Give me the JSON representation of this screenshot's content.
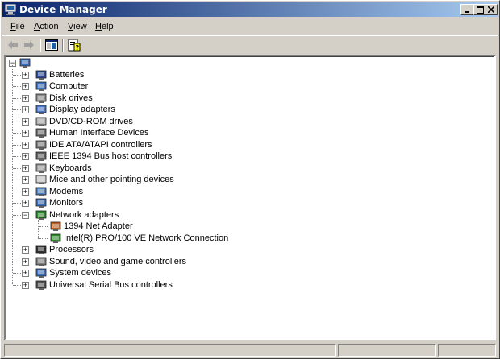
{
  "window": {
    "title": "Device Manager",
    "colors": {
      "titlebar_start": "#0a246a",
      "titlebar_end": "#a6caf0",
      "chrome": "#d4d0c8"
    }
  },
  "titlebar_buttons": {
    "minimize_icon": "minimize-icon",
    "maximize_icon": "maximize-icon",
    "close_icon": "close-icon"
  },
  "menu": {
    "file": {
      "accel": "F",
      "rest": "ile"
    },
    "action": {
      "accel": "A",
      "rest": "ction"
    },
    "view": {
      "accel": "V",
      "rest": "iew"
    },
    "help": {
      "accel": "H",
      "rest": "elp"
    }
  },
  "toolbar": {
    "back_icon": "back-arrow-icon",
    "forward_icon": "forward-arrow-icon",
    "console_tree_icon": "console-tree-icon",
    "properties_icon": "properties-help-icon"
  },
  "tree": {
    "root_label": "",
    "items": [
      {
        "label": "Batteries",
        "icon": "battery-icon"
      },
      {
        "label": "Computer",
        "icon": "computer-icon"
      },
      {
        "label": "Disk drives",
        "icon": "disk-drive-icon"
      },
      {
        "label": "Display adapters",
        "icon": "display-adapter-icon"
      },
      {
        "label": "DVD/CD-ROM drives",
        "icon": "cdrom-icon"
      },
      {
        "label": "Human Interface Devices",
        "icon": "hid-icon"
      },
      {
        "label": "IDE ATA/ATAPI controllers",
        "icon": "ide-controller-icon"
      },
      {
        "label": "IEEE 1394 Bus host controllers",
        "icon": "ieee1394-icon"
      },
      {
        "label": "Keyboards",
        "icon": "keyboard-icon"
      },
      {
        "label": "Mice and other pointing devices",
        "icon": "mouse-icon"
      },
      {
        "label": "Modems",
        "icon": "modem-icon"
      },
      {
        "label": "Monitors",
        "icon": "monitor-icon"
      },
      {
        "label": "Network adapters",
        "icon": "network-adapter-icon",
        "expanded": true,
        "children": [
          {
            "label": "1394 Net Adapter",
            "icon": "net-adapter-1394-icon"
          },
          {
            "label": "Intel(R) PRO/100 VE Network Connection",
            "icon": "nic-icon"
          }
        ]
      },
      {
        "label": "Processors",
        "icon": "processor-icon"
      },
      {
        "label": "Sound, video and game controllers",
        "icon": "sound-icon"
      },
      {
        "label": "System devices",
        "icon": "system-devices-icon"
      },
      {
        "label": "Universal Serial Bus controllers",
        "icon": "usb-icon"
      }
    ]
  }
}
